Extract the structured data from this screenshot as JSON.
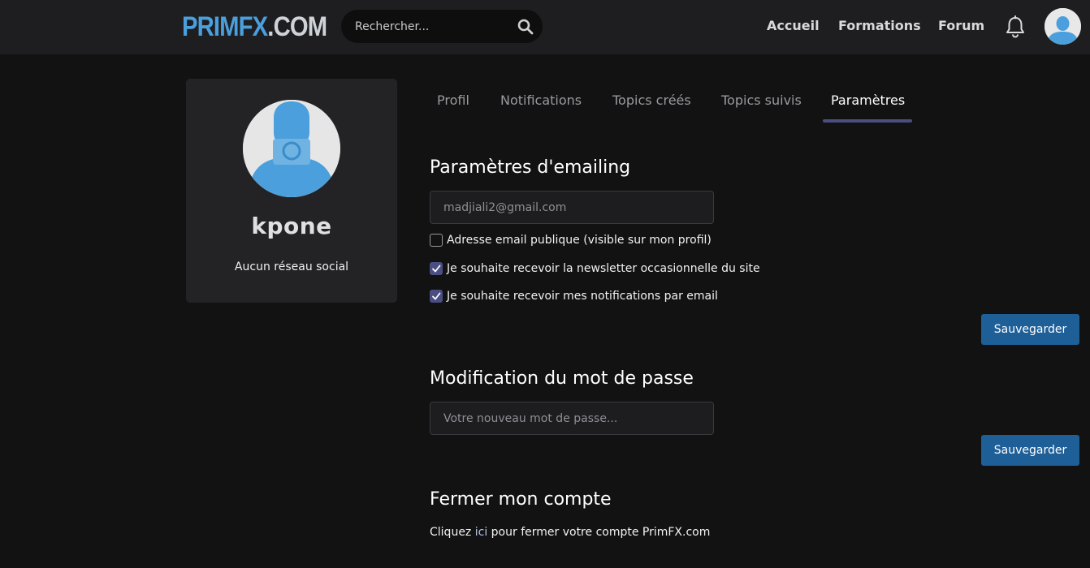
{
  "brand": {
    "logo_part1": "PRIMFX",
    "logo_part2": ".COM",
    "accent_color": "#4a9fdc"
  },
  "search": {
    "placeholder": "Rechercher...",
    "icon": "search-icon"
  },
  "nav": {
    "links": [
      "Accueil",
      "Formations",
      "Forum"
    ],
    "notifications_icon": "bell-icon",
    "avatar_icon": "user-avatar-icon"
  },
  "profile_card": {
    "username": "kpone",
    "social": "Aucun réseau social"
  },
  "tabs": {
    "items": [
      "Profil",
      "Notifications",
      "Topics créés",
      "Topics suivis",
      "Paramètres"
    ],
    "active": "Paramètres",
    "active_color": "#4a4e82"
  },
  "email_settings": {
    "title": "Paramètres d'emailing",
    "email_placeholder": "madjiali2@gmail.com",
    "options": [
      {
        "label": "Adresse email publique (visible sur mon profil)",
        "checked": false
      },
      {
        "label": "Je souhaite recevoir la newsletter occasionnelle du site",
        "checked": true
      },
      {
        "label": "Je souhaite recevoir mes notifications par email",
        "checked": true
      }
    ],
    "save_label": "Sauvegarder"
  },
  "password": {
    "title": "Modification du mot de passe",
    "placeholder": "Votre nouveau mot de passe...",
    "save_label": "Sauvegarder"
  },
  "close_account": {
    "title": "Fermer mon compte",
    "prefix": "Cliquez",
    "link": "ici",
    "suffix": "pour fermer votre compte PrimFX.com"
  },
  "colors": {
    "button": "#1e5f98",
    "page_background": "#121212",
    "topbar": "#1e1e20",
    "card": "#232326"
  }
}
